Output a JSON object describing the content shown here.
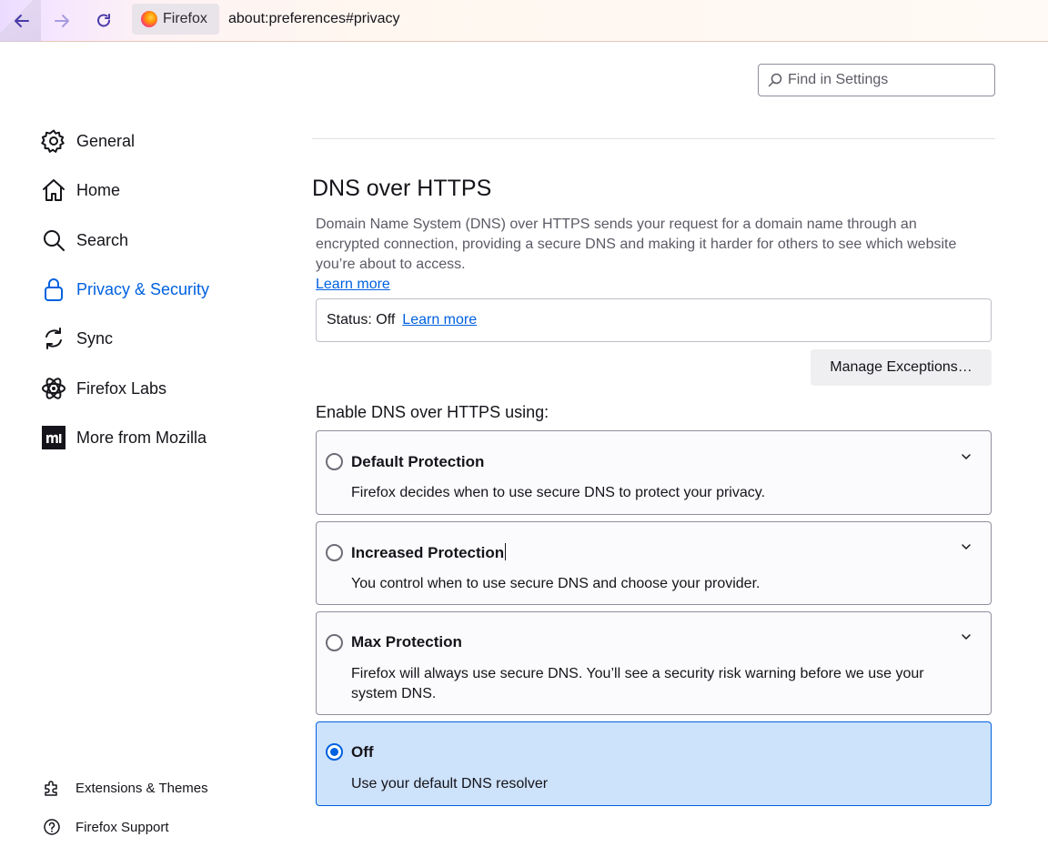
{
  "browser": {
    "identity_label": "Firefox",
    "url": "about:preferences#privacy"
  },
  "search": {
    "placeholder": "Find in Settings"
  },
  "sidebar": {
    "items": [
      {
        "label": "General",
        "icon": "gear-icon"
      },
      {
        "label": "Home",
        "icon": "home-icon"
      },
      {
        "label": "Search",
        "icon": "search-icon"
      },
      {
        "label": "Privacy & Security",
        "icon": "lock-icon"
      },
      {
        "label": "Sync",
        "icon": "sync-icon"
      },
      {
        "label": "Firefox Labs",
        "icon": "atom-icon"
      },
      {
        "label": "More from Mozilla",
        "icon": "mozilla-icon"
      }
    ],
    "active": "Privacy & Security",
    "footer": [
      {
        "label": "Extensions & Themes",
        "icon": "puzzle-icon"
      },
      {
        "label": "Firefox Support",
        "icon": "help-icon"
      }
    ]
  },
  "main": {
    "heading": "DNS over HTTPS",
    "description": "Domain Name System (DNS) over HTTPS sends your request for a domain name through an encrypted connection, providing a secure DNS and making it harder for others to see which website you’re about to access.",
    "learn_more": "Learn more",
    "status_text": "Status: Off",
    "status_learn_more": "Learn more",
    "manage_button": "Manage Exceptions…",
    "enable_label": "Enable DNS over HTTPS using:",
    "options": [
      {
        "title": "Default Protection",
        "description": "Firefox decides when to use secure DNS to protect your privacy.",
        "selected": false
      },
      {
        "title": "Increased Protection",
        "description": "You control when to use secure DNS and choose your provider.",
        "selected": false
      },
      {
        "title": "Max Protection",
        "description": "Firefox will always use secure DNS. You’ll see a security risk warning before we use your system DNS.",
        "selected": false
      },
      {
        "title": "Off",
        "description": "Use your default DNS resolver",
        "selected": true
      }
    ]
  },
  "colors": {
    "accent": "#0061e0",
    "selected_bg": "#cde2fb"
  }
}
